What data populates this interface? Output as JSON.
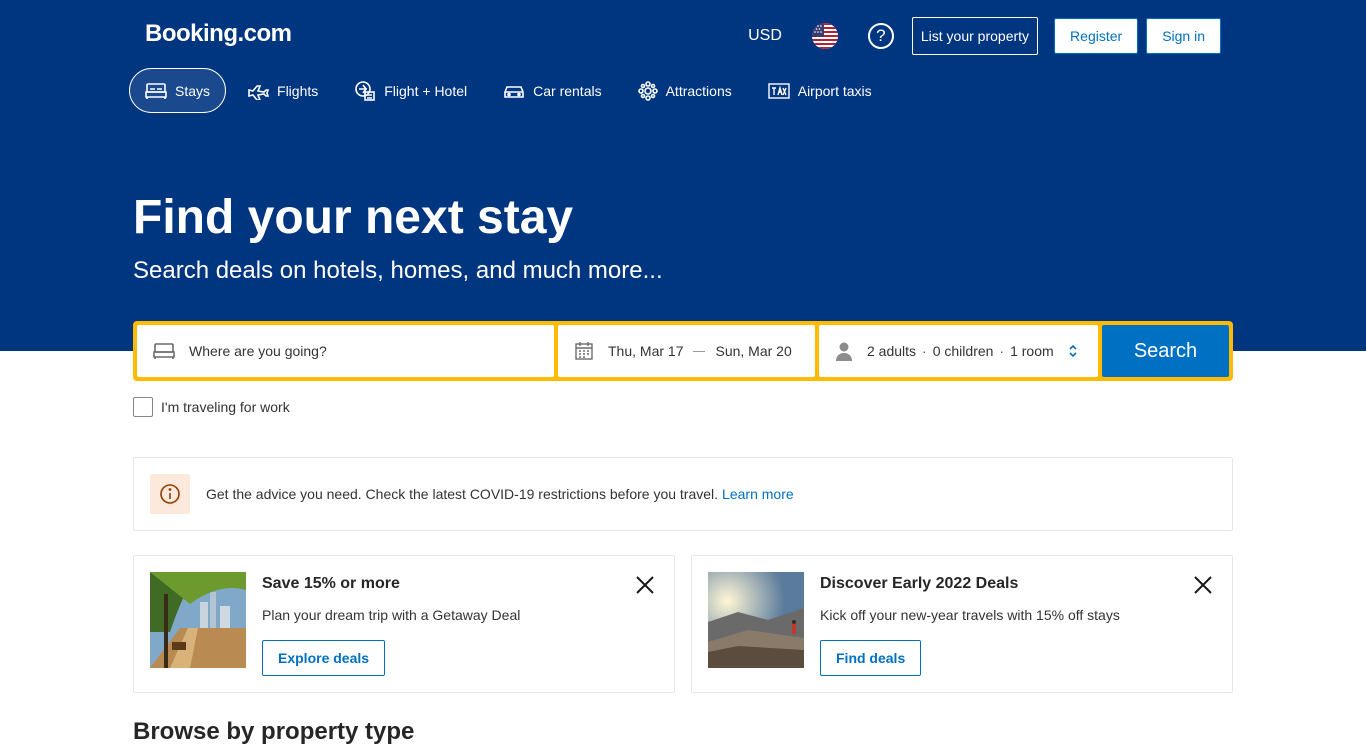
{
  "header": {
    "logo": "Booking.com",
    "currency": "USD",
    "help_icon": "question-circle-icon",
    "list_property": "List your property",
    "register": "Register",
    "sign_in": "Sign in"
  },
  "nav": {
    "items": [
      {
        "label": "Stays",
        "icon": "bed-icon",
        "active": true
      },
      {
        "label": "Flights",
        "icon": "plane-icon"
      },
      {
        "label": "Flight + Hotel",
        "icon": "flight-hotel-icon"
      },
      {
        "label": "Car rentals",
        "icon": "car-icon"
      },
      {
        "label": "Attractions",
        "icon": "attractions-icon"
      },
      {
        "label": "Airport taxis",
        "icon": "taxi-icon"
      }
    ]
  },
  "hero": {
    "title": "Find your next stay",
    "subtitle": "Search deals on hotels, homes, and much more..."
  },
  "search": {
    "destination_placeholder": "Where are you going?",
    "checkin": "Thu, Mar 17",
    "checkout": "Sun, Mar 20",
    "adults": "2 adults",
    "children": "0 children",
    "rooms": "1 room",
    "separator": "·",
    "button": "Search"
  },
  "work_travel": {
    "label": "I'm traveling for work"
  },
  "covid": {
    "text": "Get the advice you need. Check the latest COVID-19 restrictions before you travel.",
    "link": "Learn more"
  },
  "promos": [
    {
      "title": "Save 15% or more",
      "text": "Plan your dream trip with a Getaway Deal",
      "button": "Explore deals"
    },
    {
      "title": "Discover Early 2022 Deals",
      "text": "Kick off your new-year travels with 15% off stays",
      "button": "Find deals"
    }
  ],
  "browse": {
    "title": "Browse by property type"
  },
  "colors": {
    "brand_blue": "#003580",
    "accent_yellow": "#febb02",
    "link_blue": "#0071c2"
  }
}
